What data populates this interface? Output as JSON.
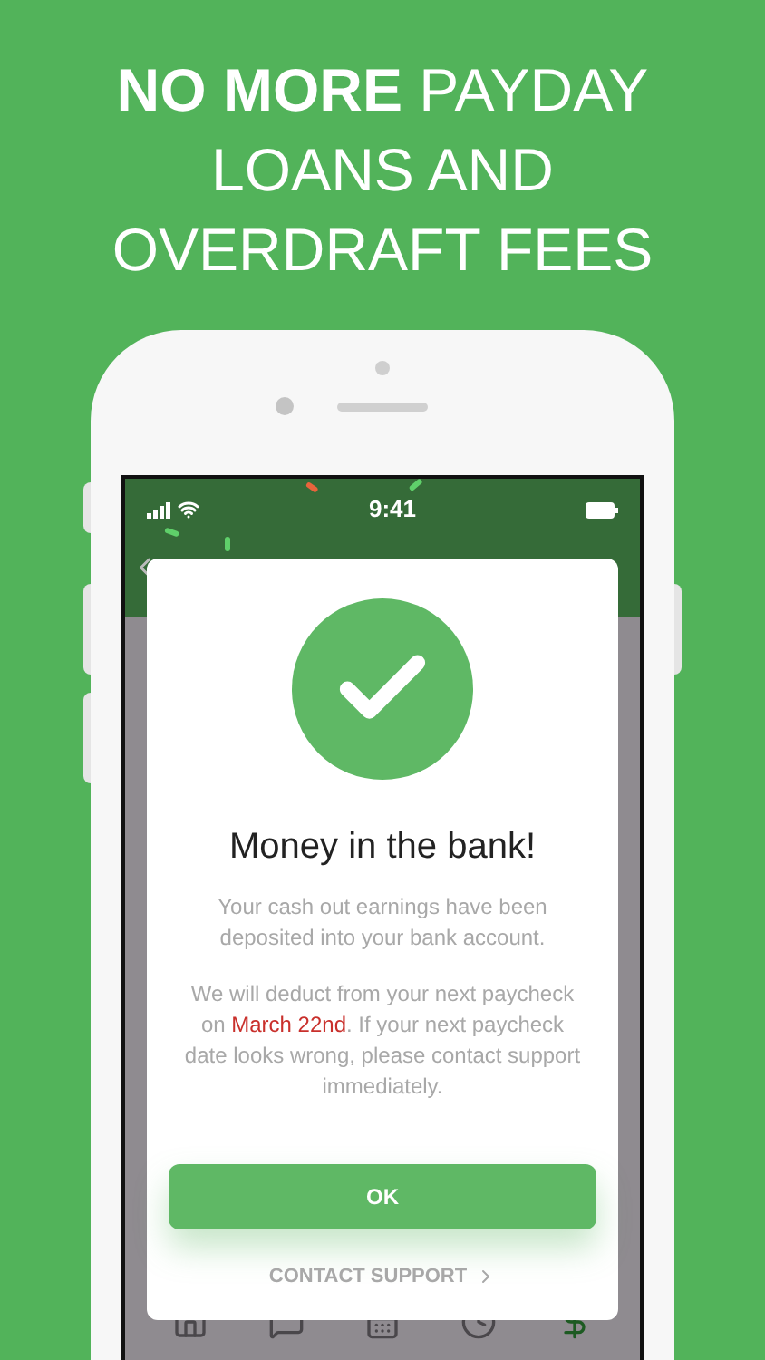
{
  "headline": "**NO MORE** PAYDAY LOANS AND OVERDRAFT FEES",
  "status_bar": {
    "time": "9:41"
  },
  "dialog": {
    "title": "Money in the bank!",
    "message": "Your cash out earnings have been deposited into your bank account.",
    "notice": "We will deduct from your next paycheck on **March 22nd**. If your next paycheck date looks wrong, please contact support immediately.",
    "ok_button": "OK",
    "support_link": "CONTACT SUPPORT"
  },
  "tab_bar": [
    {
      "kind": "home",
      "selected": false
    },
    {
      "kind": "chat",
      "selected": false
    },
    {
      "kind": "calendar",
      "selected": false
    },
    {
      "kind": "clock",
      "selected": false
    },
    {
      "kind": "dollar",
      "selected": true
    }
  ]
}
